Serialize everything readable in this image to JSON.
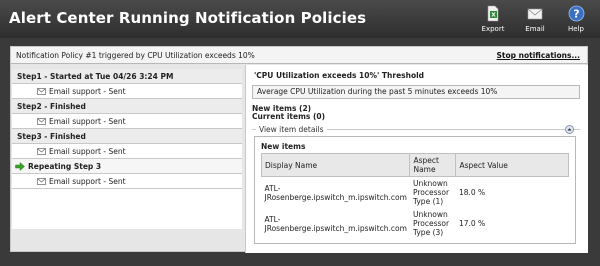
{
  "app": {
    "title": "Alert Center Running Notification Policies"
  },
  "toolbar": {
    "export_label": "Export",
    "email_label": "Email",
    "help_label": "Help"
  },
  "panel": {
    "title": "Notification Policy #1 triggered by CPU Utilization exceeds 10%",
    "stop_link": "Stop notifications..."
  },
  "steps": [
    {
      "kind": "head",
      "label": "Step1 - Started at Tue 04/26 3:24 PM"
    },
    {
      "kind": "sub",
      "label": "Email support - Sent"
    },
    {
      "kind": "head",
      "label": "Step2 - Finished"
    },
    {
      "kind": "sub",
      "label": "Email support - Sent"
    },
    {
      "kind": "head",
      "label": "Step3 - Finished"
    },
    {
      "kind": "sub",
      "label": "Email support - Sent"
    },
    {
      "kind": "active",
      "label": "Repeating Step 3"
    },
    {
      "kind": "sub",
      "label": "Email support - Sent"
    }
  ],
  "detail": {
    "threshold_title": "'CPU Utilization exceeds 10%' Threshold",
    "description": "Average CPU Utilization during the past 5 minutes exceeds 10%",
    "new_items": "New items (2)",
    "current_items": "Current items (0)",
    "view_details": "View item details",
    "new_items_label": "New items",
    "columns": [
      "Display Name",
      "Aspect Name",
      "Aspect Value"
    ],
    "rows": [
      {
        "display_name": "ATL-JRosenberge.ipswitch_m.ipswitch.com",
        "aspect_name": "Unknown Processor Type (1)",
        "aspect_value": "18.0 %"
      },
      {
        "display_name": "ATL-JRosenberge.ipswitch_m.ipswitch.com",
        "aspect_name": "Unknown Processor Type (3)",
        "aspect_value": "17.0 %"
      }
    ]
  },
  "colors": {
    "background": "#3a3a3a",
    "accent_green": "#3aa02a",
    "help_blue": "#3a6fc4"
  },
  "icons": [
    "export-icon",
    "email-icon",
    "help-icon",
    "envelope-icon",
    "green-arrow-icon",
    "collapse-icon"
  ]
}
